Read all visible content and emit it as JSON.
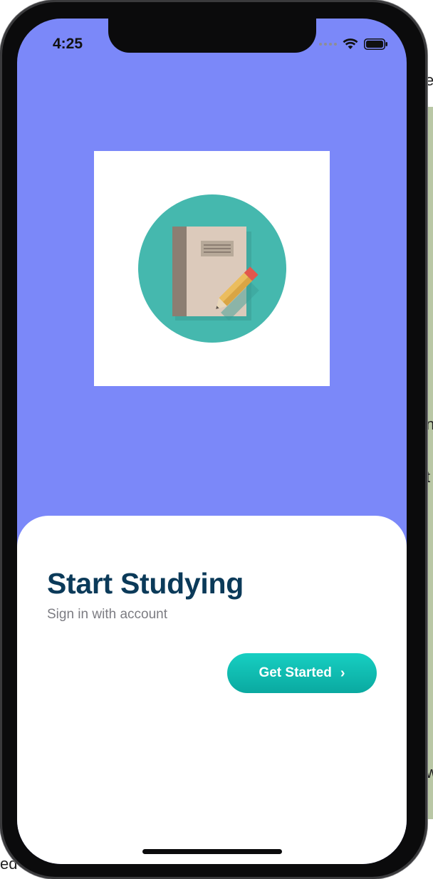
{
  "status_bar": {
    "time": "4:25"
  },
  "hero": {
    "image_icon": "notebook-and-pencil-icon",
    "panel_color": "#7b88f9"
  },
  "card": {
    "title": "Start Studying",
    "subtitle": "Sign in with account",
    "cta_label": "Get Started",
    "cta_icon": "chevron-right-icon",
    "accent": "#12bfb4",
    "title_color": "#0b3a59"
  },
  "background_peek": {
    "top_right": "e",
    "mid_right_1": "n",
    "mid_right_2": "t",
    "lower_right": "w",
    "bottom_left": "ed"
  }
}
